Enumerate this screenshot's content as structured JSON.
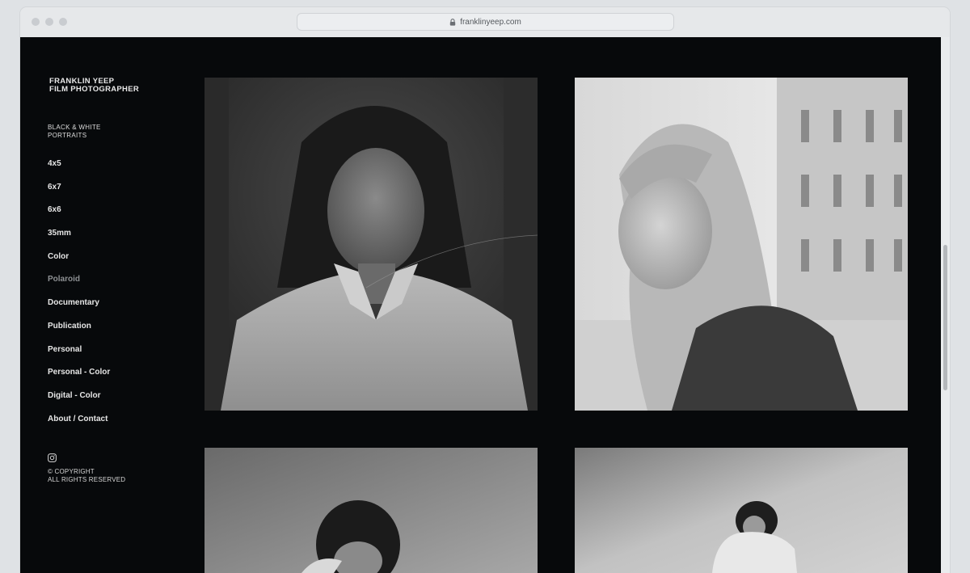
{
  "browser": {
    "url": "franklinyeep.com"
  },
  "site": {
    "brand_line1": "FRANKLIN YEEP",
    "brand_line2": "FILM PHOTOGRAPHER",
    "subtitle_line1": "BLACK & WHITE",
    "subtitle_line2": "PORTRAITS",
    "nav": [
      {
        "label": "4x5"
      },
      {
        "label": "6x7"
      },
      {
        "label": "6x6"
      },
      {
        "label": "35mm"
      },
      {
        "label": "Color"
      },
      {
        "label": "Polaroid"
      },
      {
        "label": "Documentary"
      },
      {
        "label": "Publication"
      },
      {
        "label": "Personal"
      },
      {
        "label": "Personal - Color"
      },
      {
        "label": "Digital - Color"
      },
      {
        "label": "About / Contact"
      }
    ],
    "copyright_line1": "© COPYRIGHT",
    "copyright_line2": "ALL RIGHTS RESERVED"
  },
  "gallery": {
    "photos": [
      {
        "subject": "portrait woman in collared shirt"
      },
      {
        "subject": "portrait woman looking over shoulder"
      },
      {
        "subject": "portrait woman dark hair"
      },
      {
        "subject": "portrait woman with pillow"
      }
    ]
  },
  "colors": {
    "page_background": "#07090b",
    "muted_nav": "#8e9194"
  }
}
